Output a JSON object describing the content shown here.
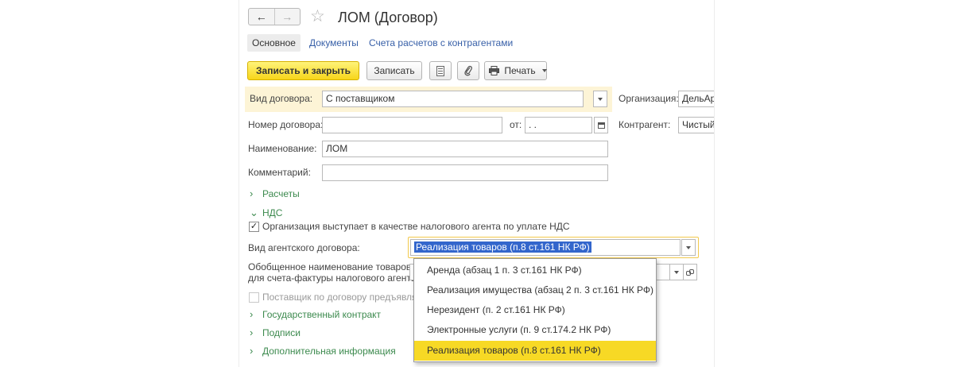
{
  "window": {
    "title": "ЛОМ (Договор)",
    "nav_back": "←",
    "nav_forward": "→",
    "favorite_icon": "star-icon"
  },
  "tabs": [
    {
      "label": "Основное",
      "active": true
    },
    {
      "label": "Документы",
      "active": false
    },
    {
      "label": "Счета расчетов с контрагентами",
      "active": false
    }
  ],
  "toolbar": {
    "save_close": "Записать и закрыть",
    "save": "Записать",
    "print": "Печать"
  },
  "form": {
    "contract_type_label": "Вид договора:",
    "contract_type_value": "С поставщиком",
    "org_label": "Организация:",
    "org_value": "ДельАр",
    "number_label": "Номер договора:",
    "number_value": "",
    "date_label": "от:",
    "date_value": ". .",
    "counterparty_label": "Контрагент:",
    "counterparty_value": "Чистый",
    "name_label": "Наименование:",
    "name_value": "ЛОМ",
    "comment_label": "Комментарий:",
    "comment_value": ""
  },
  "sections": {
    "settlements": "Расчеты",
    "vat": "НДС",
    "gov_contract": "Государственный контракт",
    "signatures": "Подписи",
    "extra_info": "Дополнительная информация"
  },
  "vat": {
    "tax_agent_label": "Организация выступает в качестве налогового агента по уплате НДС",
    "tax_agent_checked": true,
    "agent_contract_label": "Вид агентского договора:",
    "agent_contract_value": "Реализация товаров (п.8 ст.161 НК РФ)",
    "goods_name_label_1": "Обобщенное наименование товаров",
    "goods_name_label_2": "для счета-фактуры налогового агента:",
    "supplier_label": "Поставщик по договору предъявляет"
  },
  "dropdown_options": [
    {
      "label": "Аренда (абзац 1 п. 3 ст.161 НК РФ)",
      "selected": false
    },
    {
      "label": "Реализация имущества (абзац 2 п. 3 ст.161 НК РФ)",
      "selected": false
    },
    {
      "label": "Нерезидент (п. 2 ст.161 НК РФ)",
      "selected": false
    },
    {
      "label": "Электронные услуги (п. 9 ст.174.2 НК РФ)",
      "selected": false
    },
    {
      "label": "Реализация товаров (п.8 ст.161 НК РФ)",
      "selected": true
    }
  ],
  "colors": {
    "accent_yellow": "#f7d925",
    "link_blue": "#3860a8",
    "section_green": "#3c8a4e",
    "highlight_bg": "#fdf4d6",
    "selection_blue": "#3366cc"
  }
}
